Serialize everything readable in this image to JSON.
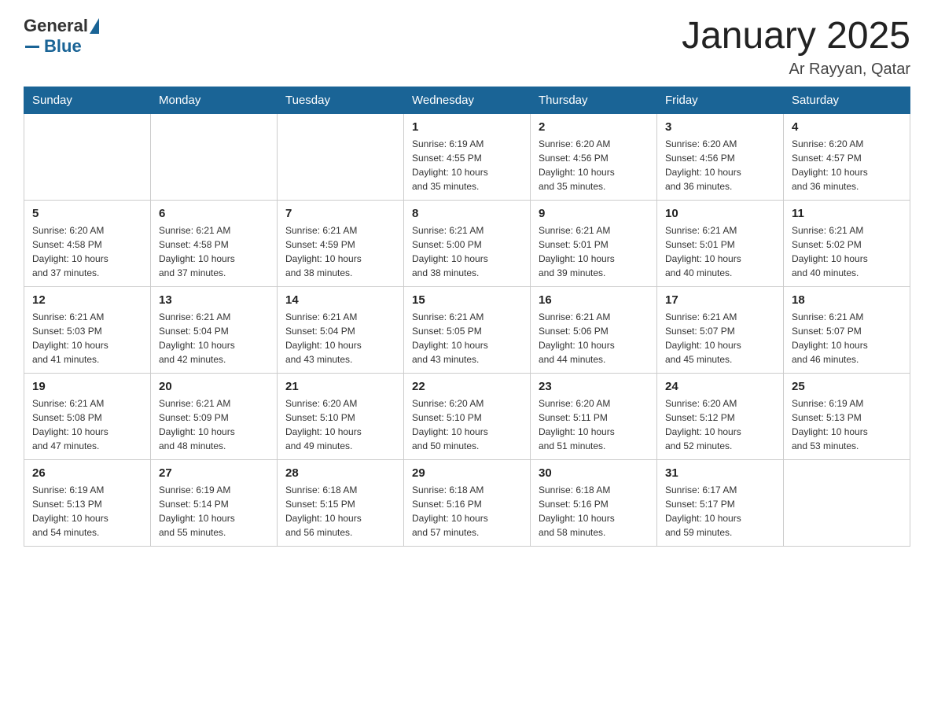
{
  "header": {
    "logo_general": "General",
    "logo_blue": "Blue",
    "title": "January 2025",
    "subtitle": "Ar Rayyan, Qatar"
  },
  "weekdays": [
    "Sunday",
    "Monday",
    "Tuesday",
    "Wednesday",
    "Thursday",
    "Friday",
    "Saturday"
  ],
  "weeks": [
    [
      {
        "day": "",
        "info": ""
      },
      {
        "day": "",
        "info": ""
      },
      {
        "day": "",
        "info": ""
      },
      {
        "day": "1",
        "info": "Sunrise: 6:19 AM\nSunset: 4:55 PM\nDaylight: 10 hours\nand 35 minutes."
      },
      {
        "day": "2",
        "info": "Sunrise: 6:20 AM\nSunset: 4:56 PM\nDaylight: 10 hours\nand 35 minutes."
      },
      {
        "day": "3",
        "info": "Sunrise: 6:20 AM\nSunset: 4:56 PM\nDaylight: 10 hours\nand 36 minutes."
      },
      {
        "day": "4",
        "info": "Sunrise: 6:20 AM\nSunset: 4:57 PM\nDaylight: 10 hours\nand 36 minutes."
      }
    ],
    [
      {
        "day": "5",
        "info": "Sunrise: 6:20 AM\nSunset: 4:58 PM\nDaylight: 10 hours\nand 37 minutes."
      },
      {
        "day": "6",
        "info": "Sunrise: 6:21 AM\nSunset: 4:58 PM\nDaylight: 10 hours\nand 37 minutes."
      },
      {
        "day": "7",
        "info": "Sunrise: 6:21 AM\nSunset: 4:59 PM\nDaylight: 10 hours\nand 38 minutes."
      },
      {
        "day": "8",
        "info": "Sunrise: 6:21 AM\nSunset: 5:00 PM\nDaylight: 10 hours\nand 38 minutes."
      },
      {
        "day": "9",
        "info": "Sunrise: 6:21 AM\nSunset: 5:01 PM\nDaylight: 10 hours\nand 39 minutes."
      },
      {
        "day": "10",
        "info": "Sunrise: 6:21 AM\nSunset: 5:01 PM\nDaylight: 10 hours\nand 40 minutes."
      },
      {
        "day": "11",
        "info": "Sunrise: 6:21 AM\nSunset: 5:02 PM\nDaylight: 10 hours\nand 40 minutes."
      }
    ],
    [
      {
        "day": "12",
        "info": "Sunrise: 6:21 AM\nSunset: 5:03 PM\nDaylight: 10 hours\nand 41 minutes."
      },
      {
        "day": "13",
        "info": "Sunrise: 6:21 AM\nSunset: 5:04 PM\nDaylight: 10 hours\nand 42 minutes."
      },
      {
        "day": "14",
        "info": "Sunrise: 6:21 AM\nSunset: 5:04 PM\nDaylight: 10 hours\nand 43 minutes."
      },
      {
        "day": "15",
        "info": "Sunrise: 6:21 AM\nSunset: 5:05 PM\nDaylight: 10 hours\nand 43 minutes."
      },
      {
        "day": "16",
        "info": "Sunrise: 6:21 AM\nSunset: 5:06 PM\nDaylight: 10 hours\nand 44 minutes."
      },
      {
        "day": "17",
        "info": "Sunrise: 6:21 AM\nSunset: 5:07 PM\nDaylight: 10 hours\nand 45 minutes."
      },
      {
        "day": "18",
        "info": "Sunrise: 6:21 AM\nSunset: 5:07 PM\nDaylight: 10 hours\nand 46 minutes."
      }
    ],
    [
      {
        "day": "19",
        "info": "Sunrise: 6:21 AM\nSunset: 5:08 PM\nDaylight: 10 hours\nand 47 minutes."
      },
      {
        "day": "20",
        "info": "Sunrise: 6:21 AM\nSunset: 5:09 PM\nDaylight: 10 hours\nand 48 minutes."
      },
      {
        "day": "21",
        "info": "Sunrise: 6:20 AM\nSunset: 5:10 PM\nDaylight: 10 hours\nand 49 minutes."
      },
      {
        "day": "22",
        "info": "Sunrise: 6:20 AM\nSunset: 5:10 PM\nDaylight: 10 hours\nand 50 minutes."
      },
      {
        "day": "23",
        "info": "Sunrise: 6:20 AM\nSunset: 5:11 PM\nDaylight: 10 hours\nand 51 minutes."
      },
      {
        "day": "24",
        "info": "Sunrise: 6:20 AM\nSunset: 5:12 PM\nDaylight: 10 hours\nand 52 minutes."
      },
      {
        "day": "25",
        "info": "Sunrise: 6:19 AM\nSunset: 5:13 PM\nDaylight: 10 hours\nand 53 minutes."
      }
    ],
    [
      {
        "day": "26",
        "info": "Sunrise: 6:19 AM\nSunset: 5:13 PM\nDaylight: 10 hours\nand 54 minutes."
      },
      {
        "day": "27",
        "info": "Sunrise: 6:19 AM\nSunset: 5:14 PM\nDaylight: 10 hours\nand 55 minutes."
      },
      {
        "day": "28",
        "info": "Sunrise: 6:18 AM\nSunset: 5:15 PM\nDaylight: 10 hours\nand 56 minutes."
      },
      {
        "day": "29",
        "info": "Sunrise: 6:18 AM\nSunset: 5:16 PM\nDaylight: 10 hours\nand 57 minutes."
      },
      {
        "day": "30",
        "info": "Sunrise: 6:18 AM\nSunset: 5:16 PM\nDaylight: 10 hours\nand 58 minutes."
      },
      {
        "day": "31",
        "info": "Sunrise: 6:17 AM\nSunset: 5:17 PM\nDaylight: 10 hours\nand 59 minutes."
      },
      {
        "day": "",
        "info": ""
      }
    ]
  ]
}
